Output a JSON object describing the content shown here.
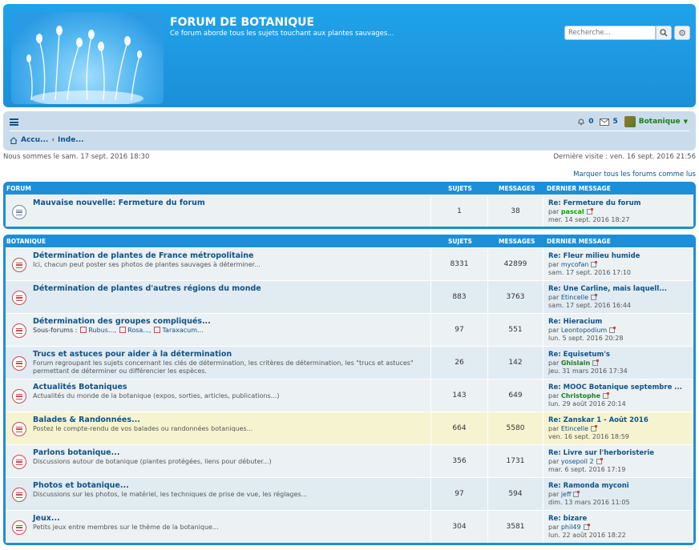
{
  "header": {
    "title": "FORUM DE BOTANIQUE",
    "description": "Ce forum aborde tous les sujets touchant aux plantes sauvages...",
    "search_placeholder": "Recherche..."
  },
  "navbar": {
    "notifications_count": "0",
    "messages_count": "5",
    "username": "Botanique",
    "breadcrumbs": [
      "Accu...",
      "Inde..."
    ]
  },
  "info": {
    "current_time": "Nous sommes le sam. 17 sept. 2016 18:30",
    "last_visit": "Dernière visite : ven. 16 sept. 2016 21:56",
    "mark_read": "Marquer tous les forums comme lus"
  },
  "columns": {
    "topics": "SUJETS",
    "posts": "MESSAGES",
    "last_post": "DERNIER MESSAGE"
  },
  "categories": [
    {
      "name": "FORUM",
      "forums": [
        {
          "title": "Mauvaise nouvelle: Fermeture du forum",
          "description": "",
          "topics": "1",
          "posts": "38",
          "last_title": "Re: Fermeture du forum",
          "last_by_prefix": "par",
          "last_user": "pascal",
          "last_date": "mer. 14 sept. 2016 18:27",
          "read": true
        }
      ]
    },
    {
      "name": "BOTANIQUE",
      "forums": [
        {
          "title": "Détermination de plantes de France métropolitaine",
          "description": "Ici, chacun peut poster ses photos de plantes sauvages à déterminer...",
          "topics": "8331",
          "posts": "42899",
          "last_title": "Re: Fleur milieu humide",
          "last_by_prefix": "par",
          "last_user": "mycofan",
          "last_date": "sam. 17 sept. 2016 17:10"
        },
        {
          "title": "Détermination de plantes d'autres régions du monde",
          "description": "",
          "topics": "883",
          "posts": "3763",
          "last_title": "Re: Une Carline, mais laquell...",
          "last_by_prefix": "par",
          "last_user": "Etincelle",
          "last_date": "sam. 17 sept. 2016 16:44"
        },
        {
          "title": "Détermination des groupes compliqués...",
          "description": "",
          "subforums_label": "Sous-forums :",
          "subforums": [
            "Rubus...,",
            "Rosa...,",
            "Taraxacum..."
          ],
          "topics": "97",
          "posts": "551",
          "last_title": "Re: Hieracium",
          "last_by_prefix": "par",
          "last_user": "Leontopodium",
          "last_date": "lun. 5 sept. 2016 20:28"
        },
        {
          "title": "Trucs et astuces pour aider à la détermination",
          "description": "Forum regroupant les sujets concernant les clés de détermination, les critères de détermination, les \"trucs et astuces\" permettant de déterminer ou différencier les espèces.",
          "topics": "26",
          "posts": "142",
          "last_title": "Re: Equisetum's",
          "last_by_prefix": "par",
          "last_user": "Ghislain",
          "last_user_style": "dgreen",
          "last_date": "jeu. 31 mars 2016 17:34"
        },
        {
          "title": "Actualités Botaniques",
          "description": "Actualités du monde de la botanique (expos, sorties, articles, publications...)",
          "topics": "143",
          "posts": "649",
          "last_title": "Re: MOOC Botanique septembre ...",
          "last_by_prefix": "par",
          "last_user": "Christophe",
          "last_user_style": "dgreen",
          "last_date": "lun. 29 août 2016 20:14"
        },
        {
          "title": "Balades & Randonnées...",
          "description": "Postez le compte-rendu de vos balades ou randonnées botaniques...",
          "topics": "664",
          "posts": "5580",
          "last_title": "Re: Zanskar 1 - Août 2016",
          "last_by_prefix": "par",
          "last_user": "Etincelle",
          "last_date": "ven. 16 sept. 2016 18:59",
          "highlight": true
        },
        {
          "title": "Parlons botanique...",
          "description": "Discussions autour de botanique (plantes protégées, liens pour débuter...)",
          "topics": "356",
          "posts": "1731",
          "last_title": "Re: Livre sur l'herboristerie",
          "last_by_prefix": "par",
          "last_user": "yosepoil 2",
          "last_date": "mar. 6 sept. 2016 17:19"
        },
        {
          "title": "Photos et botanique...",
          "description": "Discussions sur les photos, le matériel, les techniques de prise de vue, les réglages...",
          "topics": "97",
          "posts": "594",
          "last_title": "Re: Ramonda myconi",
          "last_by_prefix": "par",
          "last_user": "jeff",
          "last_date": "dim. 13 mars 2016 11:05"
        },
        {
          "title": "Jeux...",
          "description": "Petits jeux entre membres sur le thème de la botanique...",
          "topics": "304",
          "posts": "3581",
          "last_title": "Re: bizare",
          "last_by_prefix": "par",
          "last_user": "phil49",
          "last_date": "lun. 22 août 2016 18:22"
        }
      ]
    }
  ]
}
